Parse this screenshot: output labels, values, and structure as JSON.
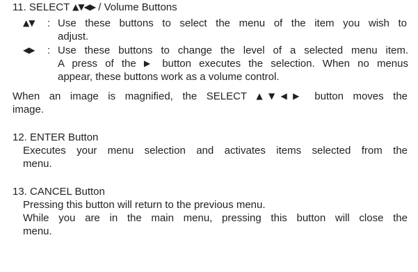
{
  "section11": {
    "heading_prefix": "11. SELECT ",
    "heading_arrows": "▲▼◀▶",
    "heading_suffix": " / Volume Buttons",
    "updown": {
      "symbol": "▲▼",
      "colon": ":",
      "line1": "Use these buttons to select the menu of the item you wish to",
      "line2": "adjust."
    },
    "leftright": {
      "symbol": "◀▶",
      "colon": ":",
      "line1": "Use these buttons to change the level of a selected menu item.",
      "line2_prefix": "A press of the ",
      "line2_arrow": "▶",
      "line2_suffix": " button executes the selection. When no menus",
      "line3": "appear, these buttons work as a volume control."
    },
    "note_prefix": "When an image is magnified, the SELECT ",
    "note_arrows": "▲▼◀▶",
    "note_suffix": " button moves the",
    "note_line2": "image."
  },
  "section12": {
    "heading": "12. ENTER Button",
    "line1": "Executes your menu selection and activates items selected from the",
    "line2": "menu."
  },
  "section13": {
    "heading": "13. CANCEL Button",
    "line1": "Pressing this button will return to the previous menu.",
    "line2": "While you are in the main menu, pressing this button will close the",
    "line3": "menu."
  }
}
